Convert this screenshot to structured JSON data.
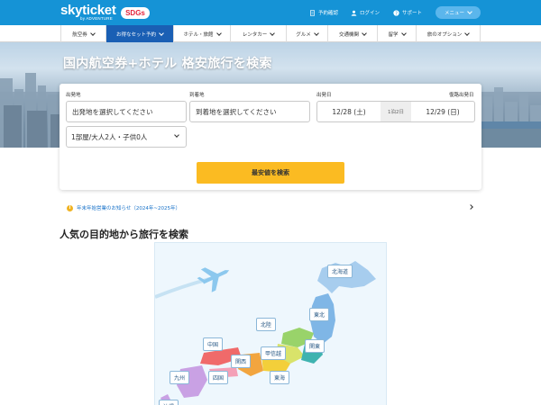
{
  "header": {
    "logo_text": "skyticket",
    "logo_sub": "by ADVENTURE",
    "sdgs_badge": "SDGs",
    "links": {
      "reservation": "予約確認",
      "login": "ログイン",
      "support": "サポート"
    },
    "menu_label": "メニュー"
  },
  "nav": {
    "items": [
      {
        "label": "航空券"
      },
      {
        "label": "お得なセット予約"
      },
      {
        "label": "ホテル・旅館"
      },
      {
        "label": "レンタカー"
      },
      {
        "label": "グルメ"
      },
      {
        "label": "交通機関"
      },
      {
        "label": "留学"
      },
      {
        "label": "旅のオプション"
      }
    ]
  },
  "hero": {
    "title": "国内航空券+ホテル 格安旅行を検索"
  },
  "search": {
    "origin_label": "出発地",
    "origin_placeholder": "出発地を選択してください",
    "destination_label": "到着地",
    "destination_placeholder": "到着地を選択してください",
    "depart_label": "出発日",
    "return_label": "復路出発日",
    "depart_date": "12/28 (土)",
    "nights": "1泊2日",
    "return_date": "12/29 (日)",
    "rooms_value": "1部屋/大人2人・子供0人",
    "search_button": "最安値を検索"
  },
  "notice": {
    "text": "年末年始営業のお知らせ（2024年~2025年）"
  },
  "section": {
    "title": "人気の目的地から旅行を検索"
  },
  "map": {
    "regions": {
      "hokkaido": "北海道",
      "tohoku": "東北",
      "hokuriku": "北陸",
      "chugoku": "中国",
      "koshinetsu": "甲信越",
      "kanto": "関東",
      "kansai": "関西",
      "kyushu": "九州",
      "shikoku": "四国",
      "tokai": "東海",
      "okinawa": "沖縄"
    }
  },
  "colors": {
    "header_blue": "#1593d6",
    "nav_active": "#1a5fb4",
    "search_button": "#fbbb22",
    "notice_link": "#1a73c9"
  }
}
